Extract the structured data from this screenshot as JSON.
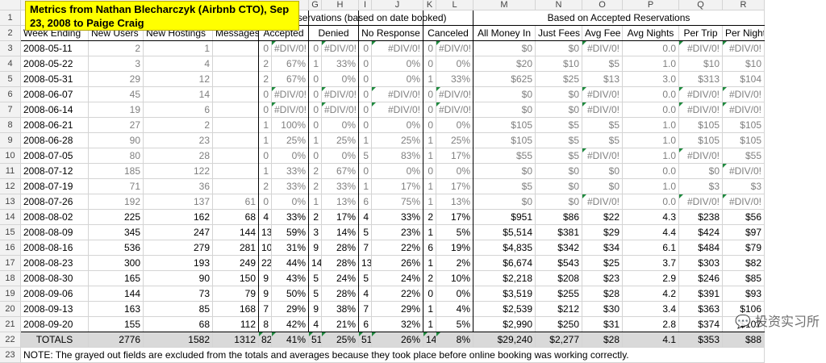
{
  "title_box": "Metrics from Nathan Blecharczyk (Airbnb CTO), Sep 23, 2008 to Paige Craig",
  "visible_col_letters": [
    "G",
    "H",
    "I",
    "J",
    "K",
    "L",
    "M",
    "N",
    "O",
    "P",
    "Q",
    "R"
  ],
  "header_row1": {
    "reservations": "Reservations (based on date booked)",
    "accepted_based": "Based on Accepted Reservations"
  },
  "header_row2": [
    "Week Ending",
    "New Users",
    "New Hostings",
    "Messages",
    "Accepted",
    "Denied",
    "No Response",
    "Canceled",
    "All Money In",
    "Just Fees",
    "Avg Fee",
    "Avg Nights",
    "Per Trip",
    "Per Night"
  ],
  "rows": [
    [
      "2008-05-11",
      "2",
      "1",
      "",
      "0",
      "#DIV/0!",
      "0",
      "#DIV/0!",
      "0",
      "#DIV/0!",
      "0",
      "#DIV/0!",
      "$0",
      "$0",
      "#DIV/0!",
      "0.0",
      "#DIV/0!",
      "#DIV/0!"
    ],
    [
      "2008-05-22",
      "3",
      "4",
      "",
      "2",
      "67%",
      "1",
      "33%",
      "0",
      "0%",
      "0",
      "0%",
      "$20",
      "$10",
      "$5",
      "1.0",
      "$10",
      "$10"
    ],
    [
      "2008-05-31",
      "29",
      "12",
      "",
      "2",
      "67%",
      "0",
      "0%",
      "0",
      "0%",
      "1",
      "33%",
      "$625",
      "$25",
      "$13",
      "3.0",
      "$313",
      "$104"
    ],
    [
      "2008-06-07",
      "45",
      "14",
      "",
      "0",
      "#DIV/0!",
      "0",
      "#DIV/0!",
      "0",
      "#DIV/0!",
      "0",
      "#DIV/0!",
      "$0",
      "$0",
      "#DIV/0!",
      "0.0",
      "#DIV/0!",
      "#DIV/0!"
    ],
    [
      "2008-06-14",
      "19",
      "6",
      "",
      "0",
      "#DIV/0!",
      "0",
      "#DIV/0!",
      "0",
      "#DIV/0!",
      "0",
      "#DIV/0!",
      "$0",
      "$0",
      "#DIV/0!",
      "0.0",
      "#DIV/0!",
      "#DIV/0!"
    ],
    [
      "2008-06-21",
      "27",
      "2",
      "",
      "1",
      "100%",
      "0",
      "0%",
      "0",
      "0%",
      "0",
      "0%",
      "$105",
      "$5",
      "$5",
      "1.0",
      "$105",
      "$105"
    ],
    [
      "2008-06-28",
      "90",
      "23",
      "",
      "1",
      "25%",
      "1",
      "25%",
      "1",
      "25%",
      "1",
      "25%",
      "$105",
      "$5",
      "$5",
      "1.0",
      "$105",
      "$105"
    ],
    [
      "2008-07-05",
      "80",
      "28",
      "",
      "0",
      "0%",
      "0",
      "0%",
      "5",
      "83%",
      "1",
      "17%",
      "$55",
      "$5",
      "#DIV/0!",
      "1.0",
      "#DIV/0!",
      "$55"
    ],
    [
      "2008-07-12",
      "185",
      "122",
      "",
      "1",
      "33%",
      "2",
      "67%",
      "0",
      "0%",
      "0",
      "0%",
      "$0",
      "$0",
      "$0",
      "0.0",
      "$0",
      "#DIV/0!"
    ],
    [
      "2008-07-19",
      "71",
      "36",
      "",
      "2",
      "33%",
      "2",
      "33%",
      "1",
      "17%",
      "1",
      "17%",
      "$5",
      "$0",
      "$0",
      "1.0",
      "$3",
      "$3"
    ],
    [
      "2008-07-26",
      "192",
      "137",
      "61",
      "0",
      "0%",
      "1",
      "13%",
      "6",
      "75%",
      "1",
      "13%",
      "$0",
      "$0",
      "#DIV/0!",
      "0.0",
      "#DIV/0!",
      "#DIV/0!"
    ],
    [
      "2008-08-02",
      "225",
      "162",
      "68",
      "4",
      "33%",
      "2",
      "17%",
      "4",
      "33%",
      "2",
      "17%",
      "$951",
      "$86",
      "$22",
      "4.3",
      "$238",
      "$56"
    ],
    [
      "2008-08-09",
      "345",
      "247",
      "144",
      "13",
      "59%",
      "3",
      "14%",
      "5",
      "23%",
      "1",
      "5%",
      "$5,514",
      "$381",
      "$29",
      "4.4",
      "$424",
      "$97"
    ],
    [
      "2008-08-16",
      "536",
      "279",
      "281",
      "10",
      "31%",
      "9",
      "28%",
      "7",
      "22%",
      "6",
      "19%",
      "$4,835",
      "$342",
      "$34",
      "6.1",
      "$484",
      "$79"
    ],
    [
      "2008-08-23",
      "300",
      "193",
      "249",
      "22",
      "44%",
      "14",
      "28%",
      "13",
      "26%",
      "1",
      "2%",
      "$6,674",
      "$543",
      "$25",
      "3.7",
      "$303",
      "$82"
    ],
    [
      "2008-08-30",
      "165",
      "90",
      "150",
      "9",
      "43%",
      "5",
      "24%",
      "5",
      "24%",
      "2",
      "10%",
      "$2,218",
      "$208",
      "$23",
      "2.9",
      "$246",
      "$85"
    ],
    [
      "2008-09-06",
      "144",
      "73",
      "79",
      "9",
      "50%",
      "5",
      "28%",
      "4",
      "22%",
      "0",
      "0%",
      "$3,519",
      "$255",
      "$28",
      "4.2",
      "$391",
      "$93"
    ],
    [
      "2008-09-13",
      "163",
      "85",
      "168",
      "7",
      "29%",
      "9",
      "38%",
      "7",
      "29%",
      "1",
      "4%",
      "$2,539",
      "$212",
      "$30",
      "3.4",
      "$363",
      "$106"
    ],
    [
      "2008-09-20",
      "155",
      "68",
      "112",
      "8",
      "42%",
      "4",
      "21%",
      "6",
      "32%",
      "1",
      "5%",
      "$2,990",
      "$250",
      "$31",
      "2.8",
      "$374",
      "$107"
    ]
  ],
  "totals": [
    "TOTALS",
    "2776",
    "1582",
    "1312",
    "82",
    "41%",
    "51",
    "25%",
    "51",
    "26%",
    "14",
    "8%",
    "$29,240",
    "$2,277",
    "$28",
    "4.1",
    "$353",
    "$88"
  ],
  "note": "NOTE: The grayed out fields are excluded from the totals and averages because they took place before online booking was working correctly.",
  "watermark": "投资实习所",
  "colors": {
    "title_fill": "#ffff00",
    "totals_fill": "#d9d9d9",
    "header_fill": "#f2f2f2",
    "error_marker": "#1e8a3e"
  }
}
